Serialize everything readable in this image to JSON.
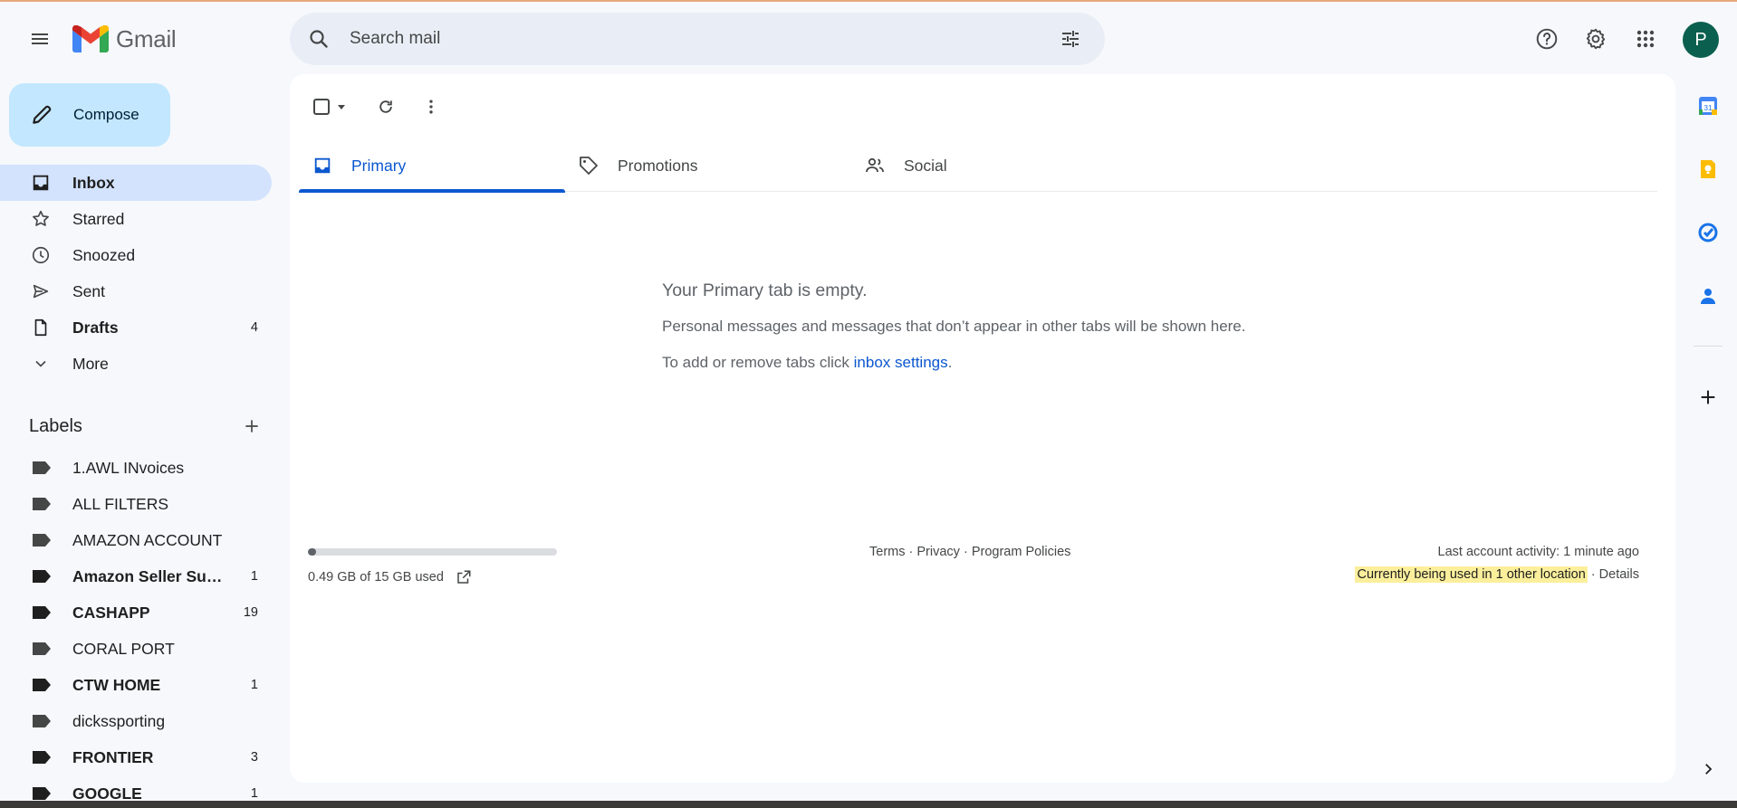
{
  "header": {
    "app_name": "Gmail",
    "search_placeholder": "Search mail",
    "avatar_letter": "P"
  },
  "compose_label": "Compose",
  "nav": {
    "items": [
      {
        "label": "Inbox",
        "count": ""
      },
      {
        "label": "Starred",
        "count": ""
      },
      {
        "label": "Snoozed",
        "count": ""
      },
      {
        "label": "Sent",
        "count": ""
      },
      {
        "label": "Drafts",
        "count": "4"
      },
      {
        "label": "More",
        "count": ""
      }
    ]
  },
  "labels": {
    "title": "Labels",
    "items": [
      {
        "label": "1.AWL INvoices",
        "count": ""
      },
      {
        "label": "ALL FILTERS",
        "count": ""
      },
      {
        "label": "AMAZON ACCOUNT",
        "count": ""
      },
      {
        "label": "Amazon Seller Sup...",
        "count": "1"
      },
      {
        "label": "CASHAPP",
        "count": "19"
      },
      {
        "label": "CORAL PORT",
        "count": ""
      },
      {
        "label": "CTW HOME",
        "count": "1"
      },
      {
        "label": "dickssporting",
        "count": ""
      },
      {
        "label": "FRONTIER",
        "count": "3"
      },
      {
        "label": "GOOGLE",
        "count": "1"
      }
    ]
  },
  "tabs": [
    {
      "label": "Primary"
    },
    {
      "label": "Promotions"
    },
    {
      "label": "Social"
    }
  ],
  "empty_state": {
    "title": "Your Primary tab is empty.",
    "description": "Personal messages and messages that don’t appear in other tabs will be shown here.",
    "settings_prefix": "To add or remove tabs click ",
    "settings_link": "inbox settings",
    "settings_suffix": "."
  },
  "footer": {
    "storage_text": "0.49 GB of 15 GB used",
    "storage_fraction": 0.033,
    "terms": "Terms",
    "privacy": "Privacy",
    "program_policies": "Program Policies",
    "separator": " · ",
    "last_activity": "Last account activity: 1 minute ago",
    "location_notice": "Currently being used in 1 other location",
    "details": "Details"
  },
  "colors": {
    "accent": "#0b57d0",
    "compose_bg": "#c2e7ff",
    "active_nav_bg": "#d3e3fd",
    "avatar_bg": "#0b5f4e"
  },
  "icons": {
    "header": [
      "menu-icon",
      "gmail-logo",
      "search-icon",
      "search-options-icon",
      "help-icon",
      "settings-icon",
      "apps-icon"
    ],
    "side_panel": [
      "calendar-icon",
      "keep-icon",
      "tasks-icon",
      "contacts-icon",
      "add-icon",
      "chevron-right-icon"
    ]
  }
}
